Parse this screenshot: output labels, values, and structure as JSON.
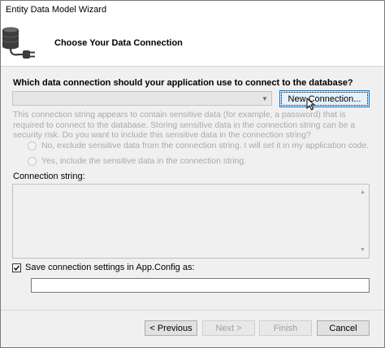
{
  "window": {
    "title": "Entity Data Model Wizard"
  },
  "header": {
    "title": "Choose Your Data Connection",
    "icon": "database-plug-icon"
  },
  "connection": {
    "question": "Which data connection should your application use to connect to the database?",
    "combo_value": "",
    "new_connection_label": "New Connection...",
    "sensitive_text": "This connection string appears to contain sensitive data (for example, a password) that is required to connect to the database. Storing sensitive data in the connection string can be a security risk. Do you want to include this sensitive data in the connection string?",
    "radio_exclude_label": "No, exclude sensitive data from the connection string. I will set it in my application code.",
    "radio_include_label": "Yes, include the sensitive data in the connection string.",
    "connection_string_label": "Connection string:",
    "connection_string_value": ""
  },
  "config": {
    "save_label": "Save connection settings in App.Config as:",
    "save_checked": true,
    "name_value": ""
  },
  "footer": {
    "previous_label": "< Previous",
    "next_label": "Next >",
    "finish_label": "Finish",
    "cancel_label": "Cancel"
  }
}
